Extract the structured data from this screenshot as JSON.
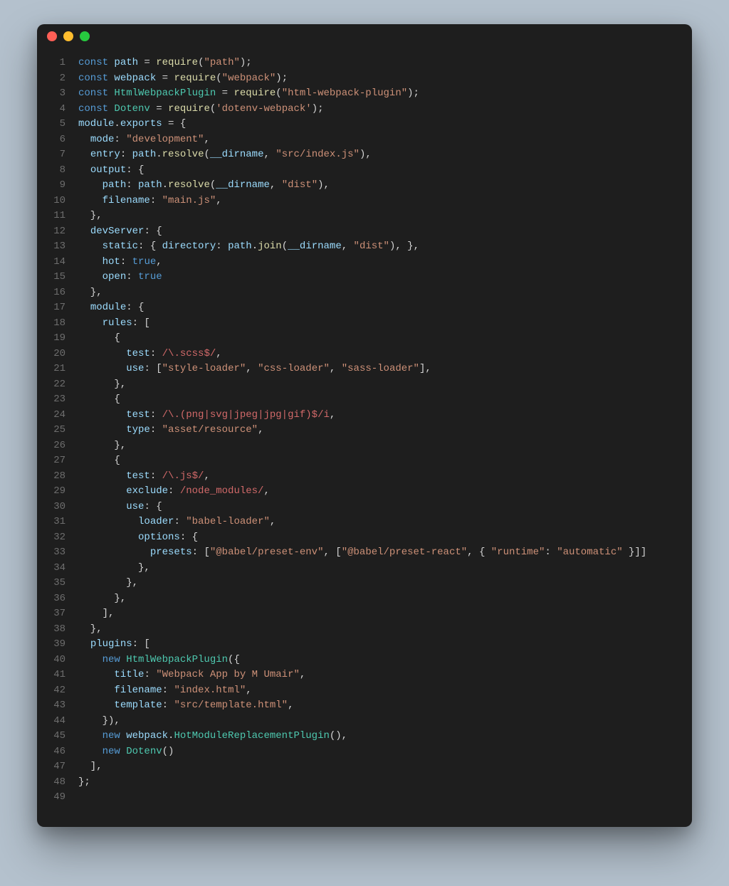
{
  "editor": {
    "lines": [
      {
        "n": 1,
        "tokens": [
          [
            "tk-kw",
            "const "
          ],
          [
            "tk-id",
            "path"
          ],
          [
            "tk-pn",
            " = "
          ],
          [
            "tk-fn",
            "require"
          ],
          [
            "tk-pn",
            "("
          ],
          [
            "tk-str",
            "\"path\""
          ],
          [
            "tk-pn",
            ");"
          ]
        ]
      },
      {
        "n": 2,
        "tokens": [
          [
            "tk-kw",
            "const "
          ],
          [
            "tk-id",
            "webpack"
          ],
          [
            "tk-pn",
            " = "
          ],
          [
            "tk-fn",
            "require"
          ],
          [
            "tk-pn",
            "("
          ],
          [
            "tk-str",
            "\"webpack\""
          ],
          [
            "tk-pn",
            ");"
          ]
        ]
      },
      {
        "n": 3,
        "tokens": [
          [
            "tk-kw",
            "const "
          ],
          [
            "tk-cls",
            "HtmlWebpackPlugin"
          ],
          [
            "tk-pn",
            " = "
          ],
          [
            "tk-fn",
            "require"
          ],
          [
            "tk-pn",
            "("
          ],
          [
            "tk-str",
            "\"html-webpack-plugin\""
          ],
          [
            "tk-pn",
            ");"
          ]
        ]
      },
      {
        "n": 4,
        "tokens": [
          [
            "tk-kw",
            "const "
          ],
          [
            "tk-cls",
            "Dotenv"
          ],
          [
            "tk-pn",
            " = "
          ],
          [
            "tk-fn",
            "require"
          ],
          [
            "tk-pn",
            "("
          ],
          [
            "tk-str",
            "'dotenv-webpack'"
          ],
          [
            "tk-pn",
            ");"
          ]
        ]
      },
      {
        "n": 5,
        "tokens": [
          [
            "tk-id",
            "module"
          ],
          [
            "tk-pn",
            "."
          ],
          [
            "tk-id",
            "exports"
          ],
          [
            "tk-pn",
            " = {"
          ]
        ]
      },
      {
        "n": 6,
        "tokens": [
          [
            "tk-pn",
            "  "
          ],
          [
            "tk-prop",
            "mode"
          ],
          [
            "tk-pn",
            ": "
          ],
          [
            "tk-str",
            "\"development\""
          ],
          [
            "tk-pn",
            ","
          ]
        ]
      },
      {
        "n": 7,
        "tokens": [
          [
            "tk-pn",
            "  "
          ],
          [
            "tk-prop",
            "entry"
          ],
          [
            "tk-pn",
            ": "
          ],
          [
            "tk-id",
            "path"
          ],
          [
            "tk-pn",
            "."
          ],
          [
            "tk-fn",
            "resolve"
          ],
          [
            "tk-pn",
            "("
          ],
          [
            "tk-id",
            "__dirname"
          ],
          [
            "tk-pn",
            ", "
          ],
          [
            "tk-str",
            "\"src/index.js\""
          ],
          [
            "tk-pn",
            "),"
          ]
        ]
      },
      {
        "n": 8,
        "tokens": [
          [
            "tk-pn",
            "  "
          ],
          [
            "tk-prop",
            "output"
          ],
          [
            "tk-pn",
            ": {"
          ]
        ]
      },
      {
        "n": 9,
        "tokens": [
          [
            "tk-pn",
            "    "
          ],
          [
            "tk-prop",
            "path"
          ],
          [
            "tk-pn",
            ": "
          ],
          [
            "tk-id",
            "path"
          ],
          [
            "tk-pn",
            "."
          ],
          [
            "tk-fn",
            "resolve"
          ],
          [
            "tk-pn",
            "("
          ],
          [
            "tk-id",
            "__dirname"
          ],
          [
            "tk-pn",
            ", "
          ],
          [
            "tk-str",
            "\"dist\""
          ],
          [
            "tk-pn",
            "),"
          ]
        ]
      },
      {
        "n": 10,
        "tokens": [
          [
            "tk-pn",
            "    "
          ],
          [
            "tk-prop",
            "filename"
          ],
          [
            "tk-pn",
            ": "
          ],
          [
            "tk-str",
            "\"main.js\""
          ],
          [
            "tk-pn",
            ","
          ]
        ]
      },
      {
        "n": 11,
        "tokens": [
          [
            "tk-pn",
            "  },"
          ]
        ]
      },
      {
        "n": 12,
        "tokens": [
          [
            "tk-pn",
            "  "
          ],
          [
            "tk-prop",
            "devServer"
          ],
          [
            "tk-pn",
            ": {"
          ]
        ]
      },
      {
        "n": 13,
        "tokens": [
          [
            "tk-pn",
            "    "
          ],
          [
            "tk-prop",
            "static"
          ],
          [
            "tk-pn",
            ": { "
          ],
          [
            "tk-prop",
            "directory"
          ],
          [
            "tk-pn",
            ": "
          ],
          [
            "tk-id",
            "path"
          ],
          [
            "tk-pn",
            "."
          ],
          [
            "tk-fn",
            "join"
          ],
          [
            "tk-pn",
            "("
          ],
          [
            "tk-id",
            "__dirname"
          ],
          [
            "tk-pn",
            ", "
          ],
          [
            "tk-str",
            "\"dist\""
          ],
          [
            "tk-pn",
            "), },"
          ]
        ]
      },
      {
        "n": 14,
        "tokens": [
          [
            "tk-pn",
            "    "
          ],
          [
            "tk-prop",
            "hot"
          ],
          [
            "tk-pn",
            ": "
          ],
          [
            "tk-bool",
            "true"
          ],
          [
            "tk-pn",
            ","
          ]
        ]
      },
      {
        "n": 15,
        "tokens": [
          [
            "tk-pn",
            "    "
          ],
          [
            "tk-prop",
            "open"
          ],
          [
            "tk-pn",
            ": "
          ],
          [
            "tk-bool",
            "true"
          ]
        ]
      },
      {
        "n": 16,
        "tokens": [
          [
            "tk-pn",
            "  },"
          ]
        ]
      },
      {
        "n": 17,
        "tokens": [
          [
            "tk-pn",
            "  "
          ],
          [
            "tk-prop",
            "module"
          ],
          [
            "tk-pn",
            ": {"
          ]
        ]
      },
      {
        "n": 18,
        "tokens": [
          [
            "tk-pn",
            "    "
          ],
          [
            "tk-prop",
            "rules"
          ],
          [
            "tk-pn",
            ": ["
          ]
        ]
      },
      {
        "n": 19,
        "tokens": [
          [
            "tk-pn",
            "      {"
          ]
        ]
      },
      {
        "n": 20,
        "tokens": [
          [
            "tk-pn",
            "        "
          ],
          [
            "tk-prop",
            "test"
          ],
          [
            "tk-pn",
            ": "
          ],
          [
            "tk-rgx",
            "/\\.scss$/"
          ],
          [
            "tk-pn",
            ","
          ]
        ]
      },
      {
        "n": 21,
        "tokens": [
          [
            "tk-pn",
            "        "
          ],
          [
            "tk-prop",
            "use"
          ],
          [
            "tk-pn",
            ": ["
          ],
          [
            "tk-str",
            "\"style-loader\""
          ],
          [
            "tk-pn",
            ", "
          ],
          [
            "tk-str",
            "\"css-loader\""
          ],
          [
            "tk-pn",
            ", "
          ],
          [
            "tk-str",
            "\"sass-loader\""
          ],
          [
            "tk-pn",
            "],"
          ]
        ]
      },
      {
        "n": 22,
        "tokens": [
          [
            "tk-pn",
            "      },"
          ]
        ]
      },
      {
        "n": 23,
        "tokens": [
          [
            "tk-pn",
            "      {"
          ]
        ]
      },
      {
        "n": 24,
        "tokens": [
          [
            "tk-pn",
            "        "
          ],
          [
            "tk-prop",
            "test"
          ],
          [
            "tk-pn",
            ": "
          ],
          [
            "tk-rgx",
            "/\\.(png|svg|jpeg|jpg|gif)$/i"
          ],
          [
            "tk-pn",
            ","
          ]
        ]
      },
      {
        "n": 25,
        "tokens": [
          [
            "tk-pn",
            "        "
          ],
          [
            "tk-prop",
            "type"
          ],
          [
            "tk-pn",
            ": "
          ],
          [
            "tk-str",
            "\"asset/resource\""
          ],
          [
            "tk-pn",
            ","
          ]
        ]
      },
      {
        "n": 26,
        "tokens": [
          [
            "tk-pn",
            "      },"
          ]
        ]
      },
      {
        "n": 27,
        "tokens": [
          [
            "tk-pn",
            "      {"
          ]
        ]
      },
      {
        "n": 28,
        "tokens": [
          [
            "tk-pn",
            "        "
          ],
          [
            "tk-prop",
            "test"
          ],
          [
            "tk-pn",
            ": "
          ],
          [
            "tk-rgx",
            "/\\.js$/"
          ],
          [
            "tk-pn",
            ","
          ]
        ]
      },
      {
        "n": 29,
        "tokens": [
          [
            "tk-pn",
            "        "
          ],
          [
            "tk-prop",
            "exclude"
          ],
          [
            "tk-pn",
            ": "
          ],
          [
            "tk-rgx",
            "/node_modules/"
          ],
          [
            "tk-pn",
            ","
          ]
        ]
      },
      {
        "n": 30,
        "tokens": [
          [
            "tk-pn",
            "        "
          ],
          [
            "tk-prop",
            "use"
          ],
          [
            "tk-pn",
            ": {"
          ]
        ]
      },
      {
        "n": 31,
        "tokens": [
          [
            "tk-pn",
            "          "
          ],
          [
            "tk-prop",
            "loader"
          ],
          [
            "tk-pn",
            ": "
          ],
          [
            "tk-str",
            "\"babel-loader\""
          ],
          [
            "tk-pn",
            ","
          ]
        ]
      },
      {
        "n": 32,
        "tokens": [
          [
            "tk-pn",
            "          "
          ],
          [
            "tk-prop",
            "options"
          ],
          [
            "tk-pn",
            ": {"
          ]
        ]
      },
      {
        "n": 33,
        "tokens": [
          [
            "tk-pn",
            "            "
          ],
          [
            "tk-prop",
            "presets"
          ],
          [
            "tk-pn",
            ": ["
          ],
          [
            "tk-str",
            "\"@babel/preset-env\""
          ],
          [
            "tk-pn",
            ", ["
          ],
          [
            "tk-str",
            "\"@babel/preset-react\""
          ],
          [
            "tk-pn",
            ", { "
          ],
          [
            "tk-str",
            "\"runtime\""
          ],
          [
            "tk-pn",
            ": "
          ],
          [
            "tk-str",
            "\"automatic\""
          ],
          [
            "tk-pn",
            " }]]"
          ]
        ]
      },
      {
        "n": 34,
        "tokens": [
          [
            "tk-pn",
            "          },"
          ]
        ]
      },
      {
        "n": 35,
        "tokens": [
          [
            "tk-pn",
            "        },"
          ]
        ]
      },
      {
        "n": 36,
        "tokens": [
          [
            "tk-pn",
            "      },"
          ]
        ]
      },
      {
        "n": 37,
        "tokens": [
          [
            "tk-pn",
            "    ],"
          ]
        ]
      },
      {
        "n": 38,
        "tokens": [
          [
            "tk-pn",
            "  },"
          ]
        ]
      },
      {
        "n": 39,
        "tokens": [
          [
            "tk-pn",
            "  "
          ],
          [
            "tk-prop",
            "plugins"
          ],
          [
            "tk-pn",
            ": ["
          ]
        ]
      },
      {
        "n": 40,
        "tokens": [
          [
            "tk-pn",
            "    "
          ],
          [
            "tk-kw",
            "new "
          ],
          [
            "tk-cls",
            "HtmlWebpackPlugin"
          ],
          [
            "tk-pn",
            "({"
          ]
        ]
      },
      {
        "n": 41,
        "tokens": [
          [
            "tk-pn",
            "      "
          ],
          [
            "tk-prop",
            "title"
          ],
          [
            "tk-pn",
            ": "
          ],
          [
            "tk-str",
            "\"Webpack App by M Umair\""
          ],
          [
            "tk-pn",
            ","
          ]
        ]
      },
      {
        "n": 42,
        "tokens": [
          [
            "tk-pn",
            "      "
          ],
          [
            "tk-prop",
            "filename"
          ],
          [
            "tk-pn",
            ": "
          ],
          [
            "tk-str",
            "\"index.html\""
          ],
          [
            "tk-pn",
            ","
          ]
        ]
      },
      {
        "n": 43,
        "tokens": [
          [
            "tk-pn",
            "      "
          ],
          [
            "tk-prop",
            "template"
          ],
          [
            "tk-pn",
            ": "
          ],
          [
            "tk-str",
            "\"src/template.html\""
          ],
          [
            "tk-pn",
            ","
          ]
        ]
      },
      {
        "n": 44,
        "tokens": [
          [
            "tk-pn",
            "    }),"
          ]
        ]
      },
      {
        "n": 45,
        "tokens": [
          [
            "tk-pn",
            "    "
          ],
          [
            "tk-kw",
            "new "
          ],
          [
            "tk-id",
            "webpack"
          ],
          [
            "tk-pn",
            "."
          ],
          [
            "tk-cls",
            "HotModuleReplacementPlugin"
          ],
          [
            "tk-pn",
            "(),"
          ]
        ]
      },
      {
        "n": 46,
        "tokens": [
          [
            "tk-pn",
            "    "
          ],
          [
            "tk-kw",
            "new "
          ],
          [
            "tk-cls",
            "Dotenv"
          ],
          [
            "tk-pn",
            "()"
          ]
        ]
      },
      {
        "n": 47,
        "tokens": [
          [
            "tk-pn",
            "  ],"
          ]
        ]
      },
      {
        "n": 48,
        "tokens": [
          [
            "tk-pn",
            "};"
          ]
        ]
      },
      {
        "n": 49,
        "tokens": []
      }
    ]
  }
}
